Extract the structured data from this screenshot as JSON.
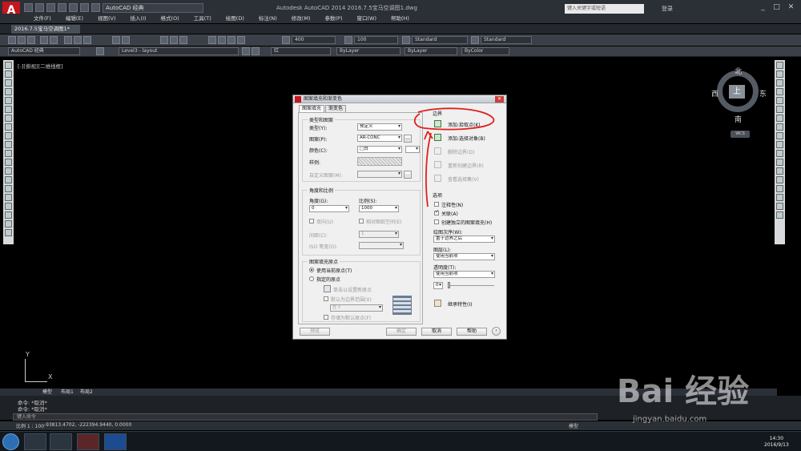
{
  "app": {
    "logo": "A",
    "workspace": "AutoCAD 经典",
    "title": "Autodesk AutoCAD 2014    2016.7.5宝马空调图1.dwg",
    "search_placeholder": "键入关键字或短语",
    "login": "登录",
    "win_min": "_",
    "win_max": "□",
    "win_close": "✕"
  },
  "menu": [
    "文件(F)",
    "编辑(E)",
    "视图(V)",
    "插入(I)",
    "格式(O)",
    "工具(T)",
    "绘图(D)",
    "标注(N)",
    "修改(M)",
    "参数(P)",
    "窗口(W)",
    "帮助(H)"
  ],
  "doc_tab": "2016.7.5宝马空调图1*",
  "toolbar": {
    "lineweight": "400",
    "scale": "100",
    "text_style": "Standard",
    "dim_style": "Standard",
    "ws2": "AutoCAD 经典",
    "layer": "Level3 - layout",
    "color": "红",
    "linetype": "ByLayer",
    "lineweight2": "ByLayer",
    "plotstyle": "ByColor"
  },
  "viewport_label": "[-][俯视][二维线框]",
  "compass": {
    "north": "北",
    "south": "南",
    "east": "东",
    "west": "西",
    "top": "上",
    "wcs": "WCS"
  },
  "ucs": {
    "x": "X",
    "y": "Y"
  },
  "layout_tabs": [
    "模型",
    "布局1",
    "布局2"
  ],
  "command_history": [
    "命令: *取消*",
    "命令: *取消*"
  ],
  "command_prompt": "键入命令",
  "status": {
    "scale": "比例 1 : 100",
    "coords": "-93813.4702, -222394.9440, 0.0000",
    "model": "模型"
  },
  "clock": {
    "time": "14:30",
    "date": "2016/9/13"
  },
  "dialog": {
    "title": "图案填充和渐变色",
    "close": "✕",
    "tabs": [
      "图案填充",
      "渐变色"
    ],
    "type_pattern_group": "类型和图案",
    "type_label": "类型(Y):",
    "type_value": "预定义",
    "pattern_label": "图案(P):",
    "pattern_value": "AR-CONC",
    "color_label": "颜色(C):",
    "color_value": "□白",
    "swatch_label": "样例:",
    "custom_label": "自定义图案(M):",
    "angle_scale_group": "角度和比例",
    "angle_label": "角度(G):",
    "angle_value": "0",
    "scale_label": "比例(S):",
    "scale_value": "1000",
    "double_label": "双向(U)",
    "relative_label": "相对图纸空间(E)",
    "spacing_label": "间距(C):",
    "spacing_value": "1",
    "iso_label": "ISO 笔宽(O):",
    "origin_group": "图案填充原点",
    "use_current_origin": "使用当前原点(T)",
    "specified_origin": "指定的原点",
    "click_set_origin": "单击以设置新原点",
    "default_boundary": "默认为边界范围(X)",
    "boundary_pos": "左下",
    "store_default": "存储为默认原点(F)",
    "boundary_group": "边界",
    "add_pick": "添加:拾取点(K)",
    "add_select": "添加:选择对象(B)",
    "remove_boundary": "删除边界(D)",
    "recreate_boundary": "重新创建边界(R)",
    "view_selection": "查看选择集(V)",
    "options_group": "选项",
    "annotative": "注释性(N)",
    "associative": "关联(A)",
    "separate": "创建独立的图案填充(H)",
    "draw_order_label": "绘图次序(W):",
    "draw_order_value": "置于边界之后",
    "layer_label": "图层(L):",
    "layer_value": "使用当前项",
    "transparency_label": "透明度(T):",
    "transparency_value": "使用当前项",
    "transparency_num": "0",
    "inherit": "继承特性(I)",
    "preview": "预览",
    "ok": "确定",
    "cancel": "取消",
    "help": "帮助",
    "more": "›"
  },
  "watermark": {
    "main": "Bai 经验",
    "sub": "jingyan.baidu.com"
  },
  "colors": {
    "annotation": "#e0201c",
    "autocad_red": "#c4161c"
  }
}
